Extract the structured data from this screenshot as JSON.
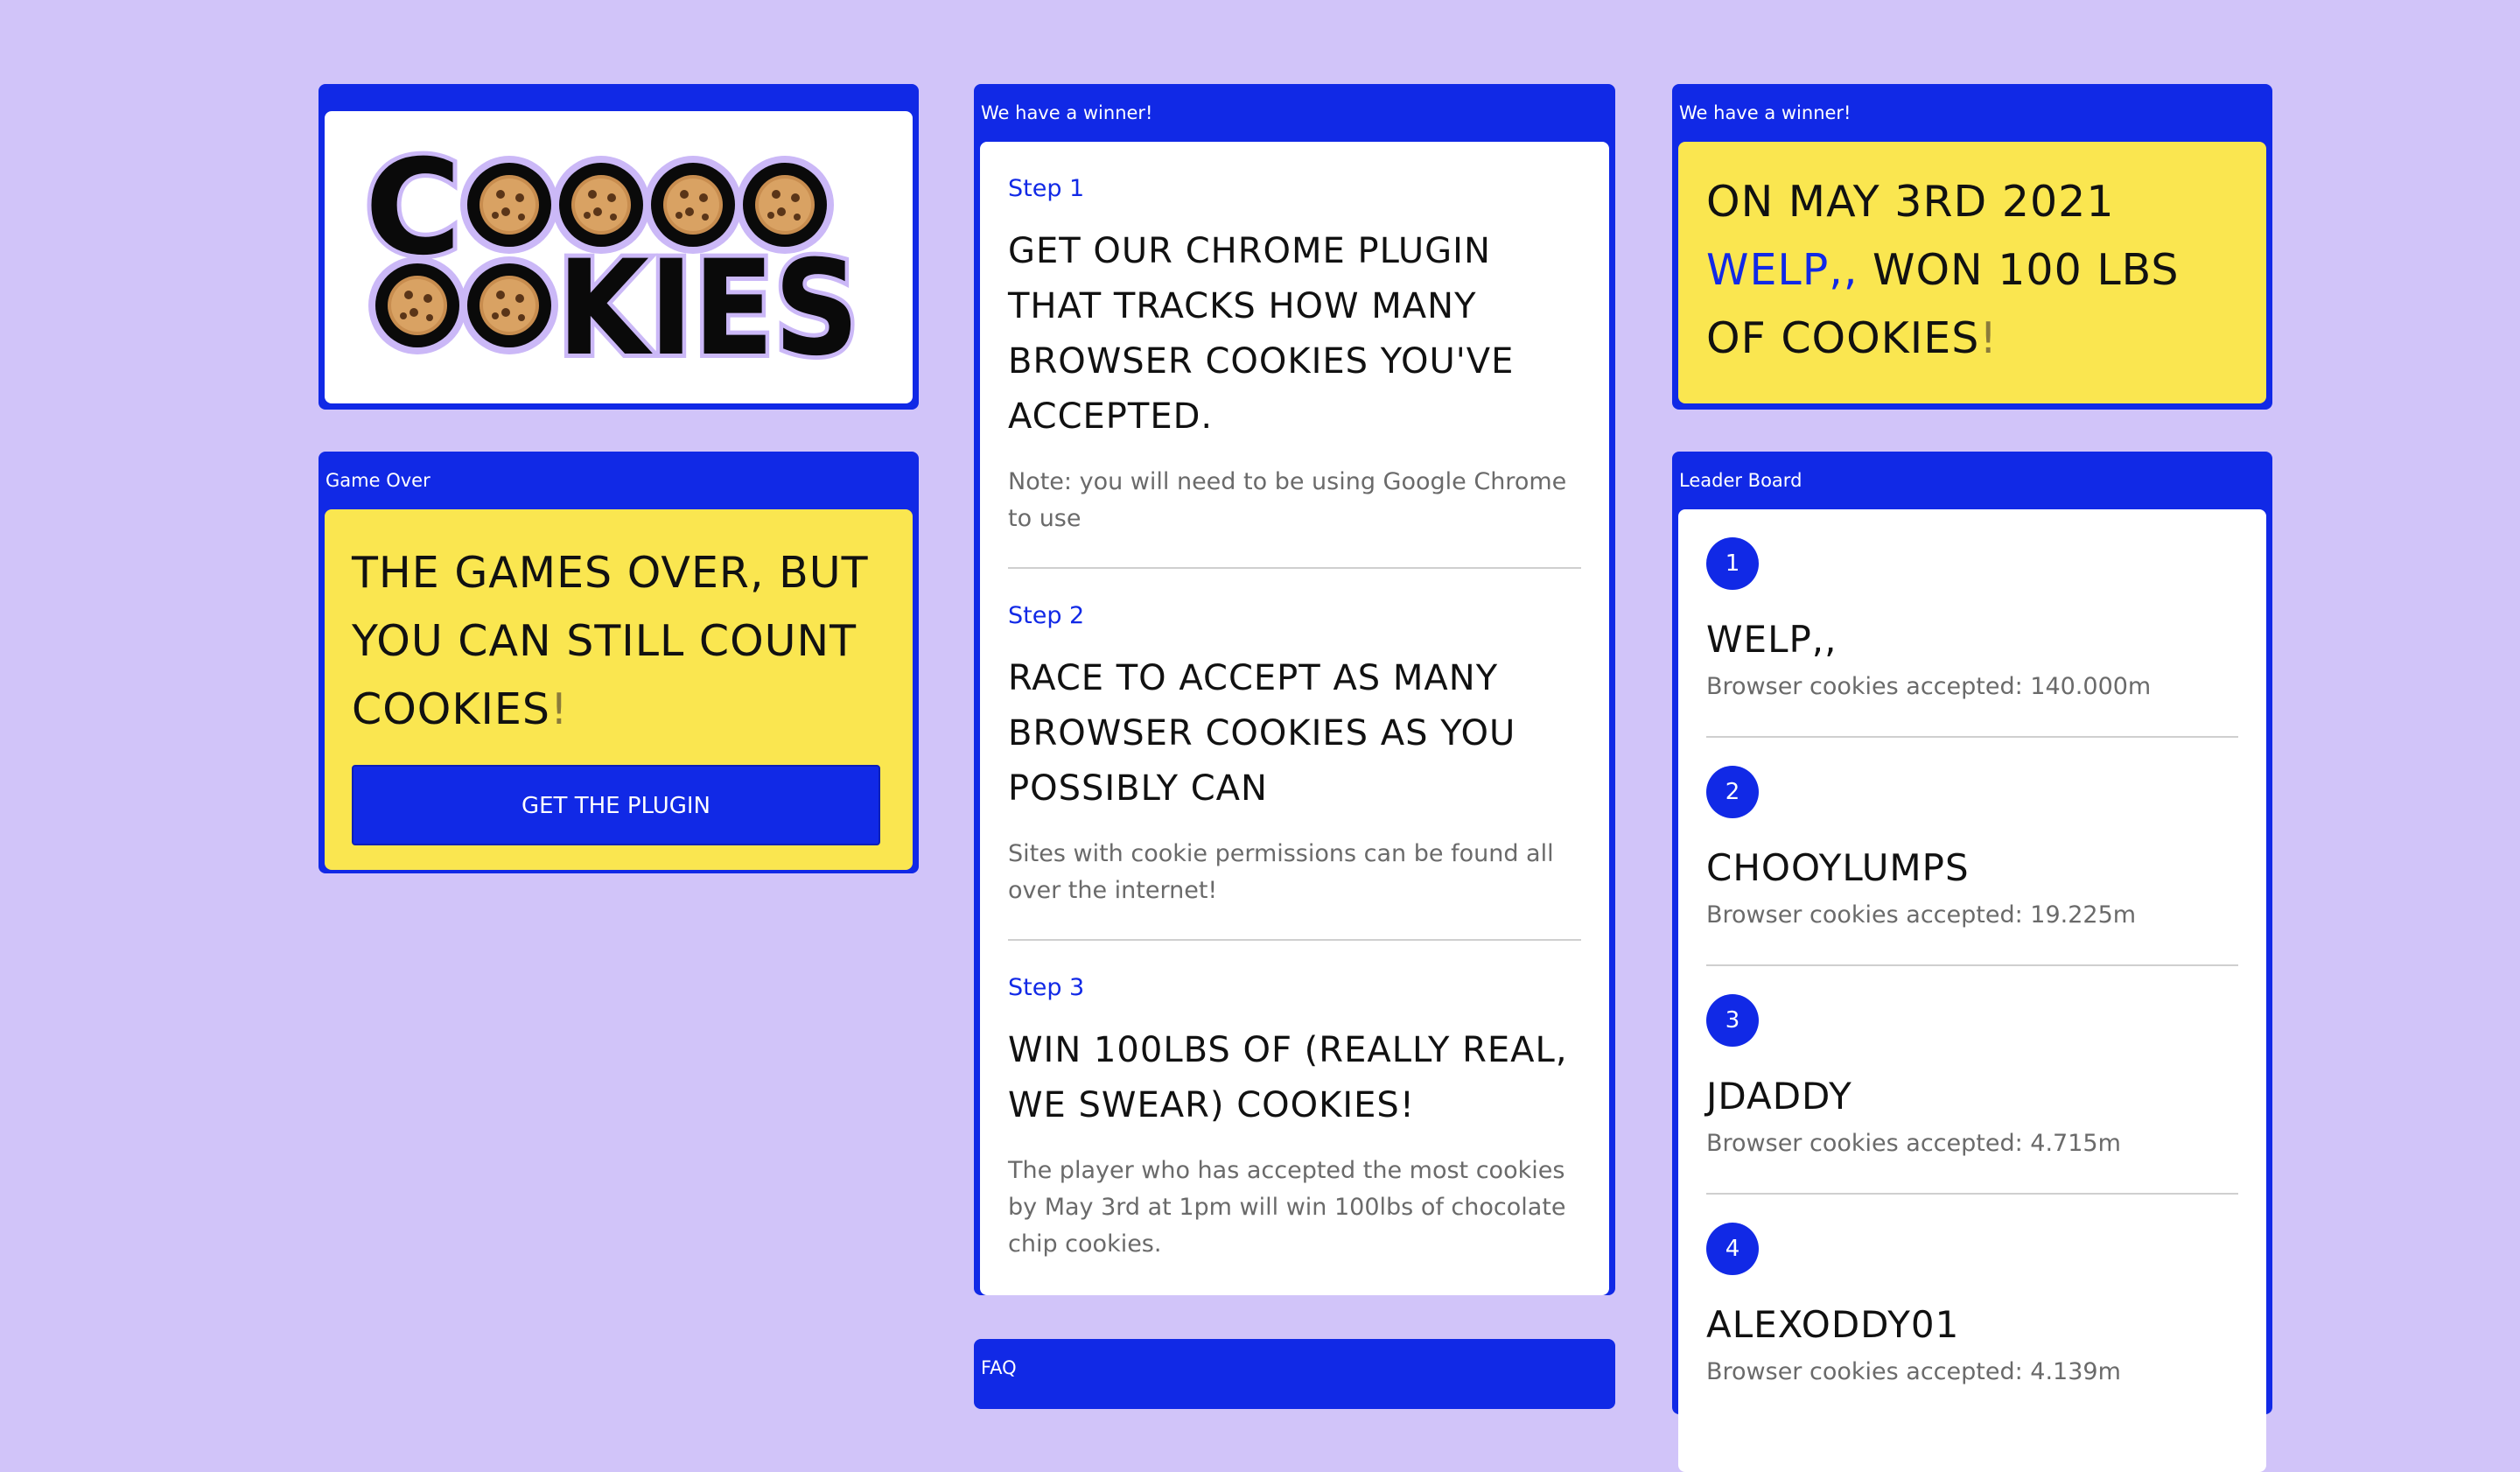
{
  "logo": {
    "line1": "COOOO",
    "line2": "OOKIES",
    "cookie_icon": "cookie-icon",
    "colors": {
      "letter": "#0a0a0a",
      "outline": "#cbb8f7",
      "cookie": "#c88d4f",
      "chip": "#5a3518"
    }
  },
  "game_over": {
    "title": "Game Over",
    "headline": "THE GAMES OVER, BUT YOU CAN STILL COUNT COOKIES",
    "headline_end": "!",
    "button": "GET THE PLUGIN"
  },
  "steps": {
    "title": "We have a winner!",
    "items": [
      {
        "label": "Step 1",
        "headline": "GET OUR CHROME PLUGIN THAT TRACKS HOW MANY BROWSER COOKIES YOU'VE ACCEPTED.",
        "note": "Note: you will need to be using Google Chrome to use"
      },
      {
        "label": "Step 2",
        "headline": "RACE TO ACCEPT AS MANY BROWSER COOKIES AS YOU POSSIBLY CAN",
        "note": "Sites with cookie permissions can be found all over the internet!"
      },
      {
        "label": "Step 3",
        "headline": "WIN 100LBS OF (REALLY REAL, WE SWEAR) COOKIES!",
        "note": "The player who has accepted the most cookies by May 3rd at 1pm will win 100lbs of chocolate chip cookies."
      }
    ]
  },
  "faq": {
    "title": "FAQ"
  },
  "winner": {
    "title": "We have a winner!",
    "line_start": "ON MAY 3RD 2021",
    "name": "WELP,,",
    "line_end": "WON 100 LBS OF COOKIES",
    "excl": "!"
  },
  "leaderboard": {
    "title": "Leader Board",
    "rows": [
      {
        "rank": "1",
        "name": "WELP,,",
        "count": "Browser cookies accepted: 140.000m"
      },
      {
        "rank": "2",
        "name": "CHOOYLUMPS",
        "count": "Browser cookies accepted: 19.225m"
      },
      {
        "rank": "3",
        "name": "JDADDY",
        "count": "Browser cookies accepted: 4.715m"
      },
      {
        "rank": "4",
        "name": "ALEXODDY01",
        "count": "Browser cookies accepted: 4.139m"
      }
    ]
  },
  "theme": {
    "background": "#d1c4f9",
    "blue": "#1129e6",
    "yellow": "#fae650"
  }
}
